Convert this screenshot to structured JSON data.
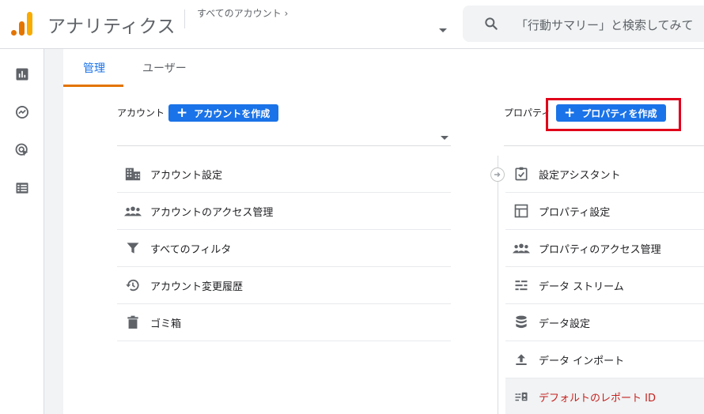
{
  "header": {
    "app_title": "アナリティクス",
    "account_crumb": "すべてのアカウント ›",
    "search_placeholder": "「行動サマリー」と検索してみて"
  },
  "leftnav": {
    "items": [
      {
        "icon": "reports-icon"
      },
      {
        "icon": "explore-icon"
      },
      {
        "icon": "advertising-icon"
      },
      {
        "icon": "configure-icon"
      }
    ]
  },
  "tabs": [
    {
      "label": "管理",
      "active": true
    },
    {
      "label": "ユーザー",
      "active": false
    }
  ],
  "account": {
    "label": "アカウント",
    "create_label": "アカウントを作成",
    "items": [
      {
        "label": "アカウント設定",
        "icon": "building-icon"
      },
      {
        "label": "アカウントのアクセス管理",
        "icon": "people-icon"
      },
      {
        "label": "すべてのフィルタ",
        "icon": "filter-icon"
      },
      {
        "label": "アカウント変更履歴",
        "icon": "history-icon"
      },
      {
        "label": "ゴミ箱",
        "icon": "trash-icon"
      }
    ]
  },
  "property": {
    "label": "プロパティ",
    "create_label": "プロパティを作成",
    "items": [
      {
        "label": "設定アシスタント",
        "icon": "checklist-icon"
      },
      {
        "label": "プロパティ設定",
        "icon": "layout-icon"
      },
      {
        "label": "プロパティのアクセス管理",
        "icon": "people-icon"
      },
      {
        "label": "データ ストリーム",
        "icon": "streams-icon"
      },
      {
        "label": "データ設定",
        "icon": "database-icon"
      },
      {
        "label": "データ インポート",
        "icon": "upload-icon"
      },
      {
        "label": "デフォルトのレポート ID",
        "icon": "report-id-icon"
      }
    ]
  },
  "colors": {
    "accent": "#1a73e8",
    "tab_underline": "#e37400",
    "highlight": "#e0001a",
    "warning_text": "#c5221f"
  }
}
